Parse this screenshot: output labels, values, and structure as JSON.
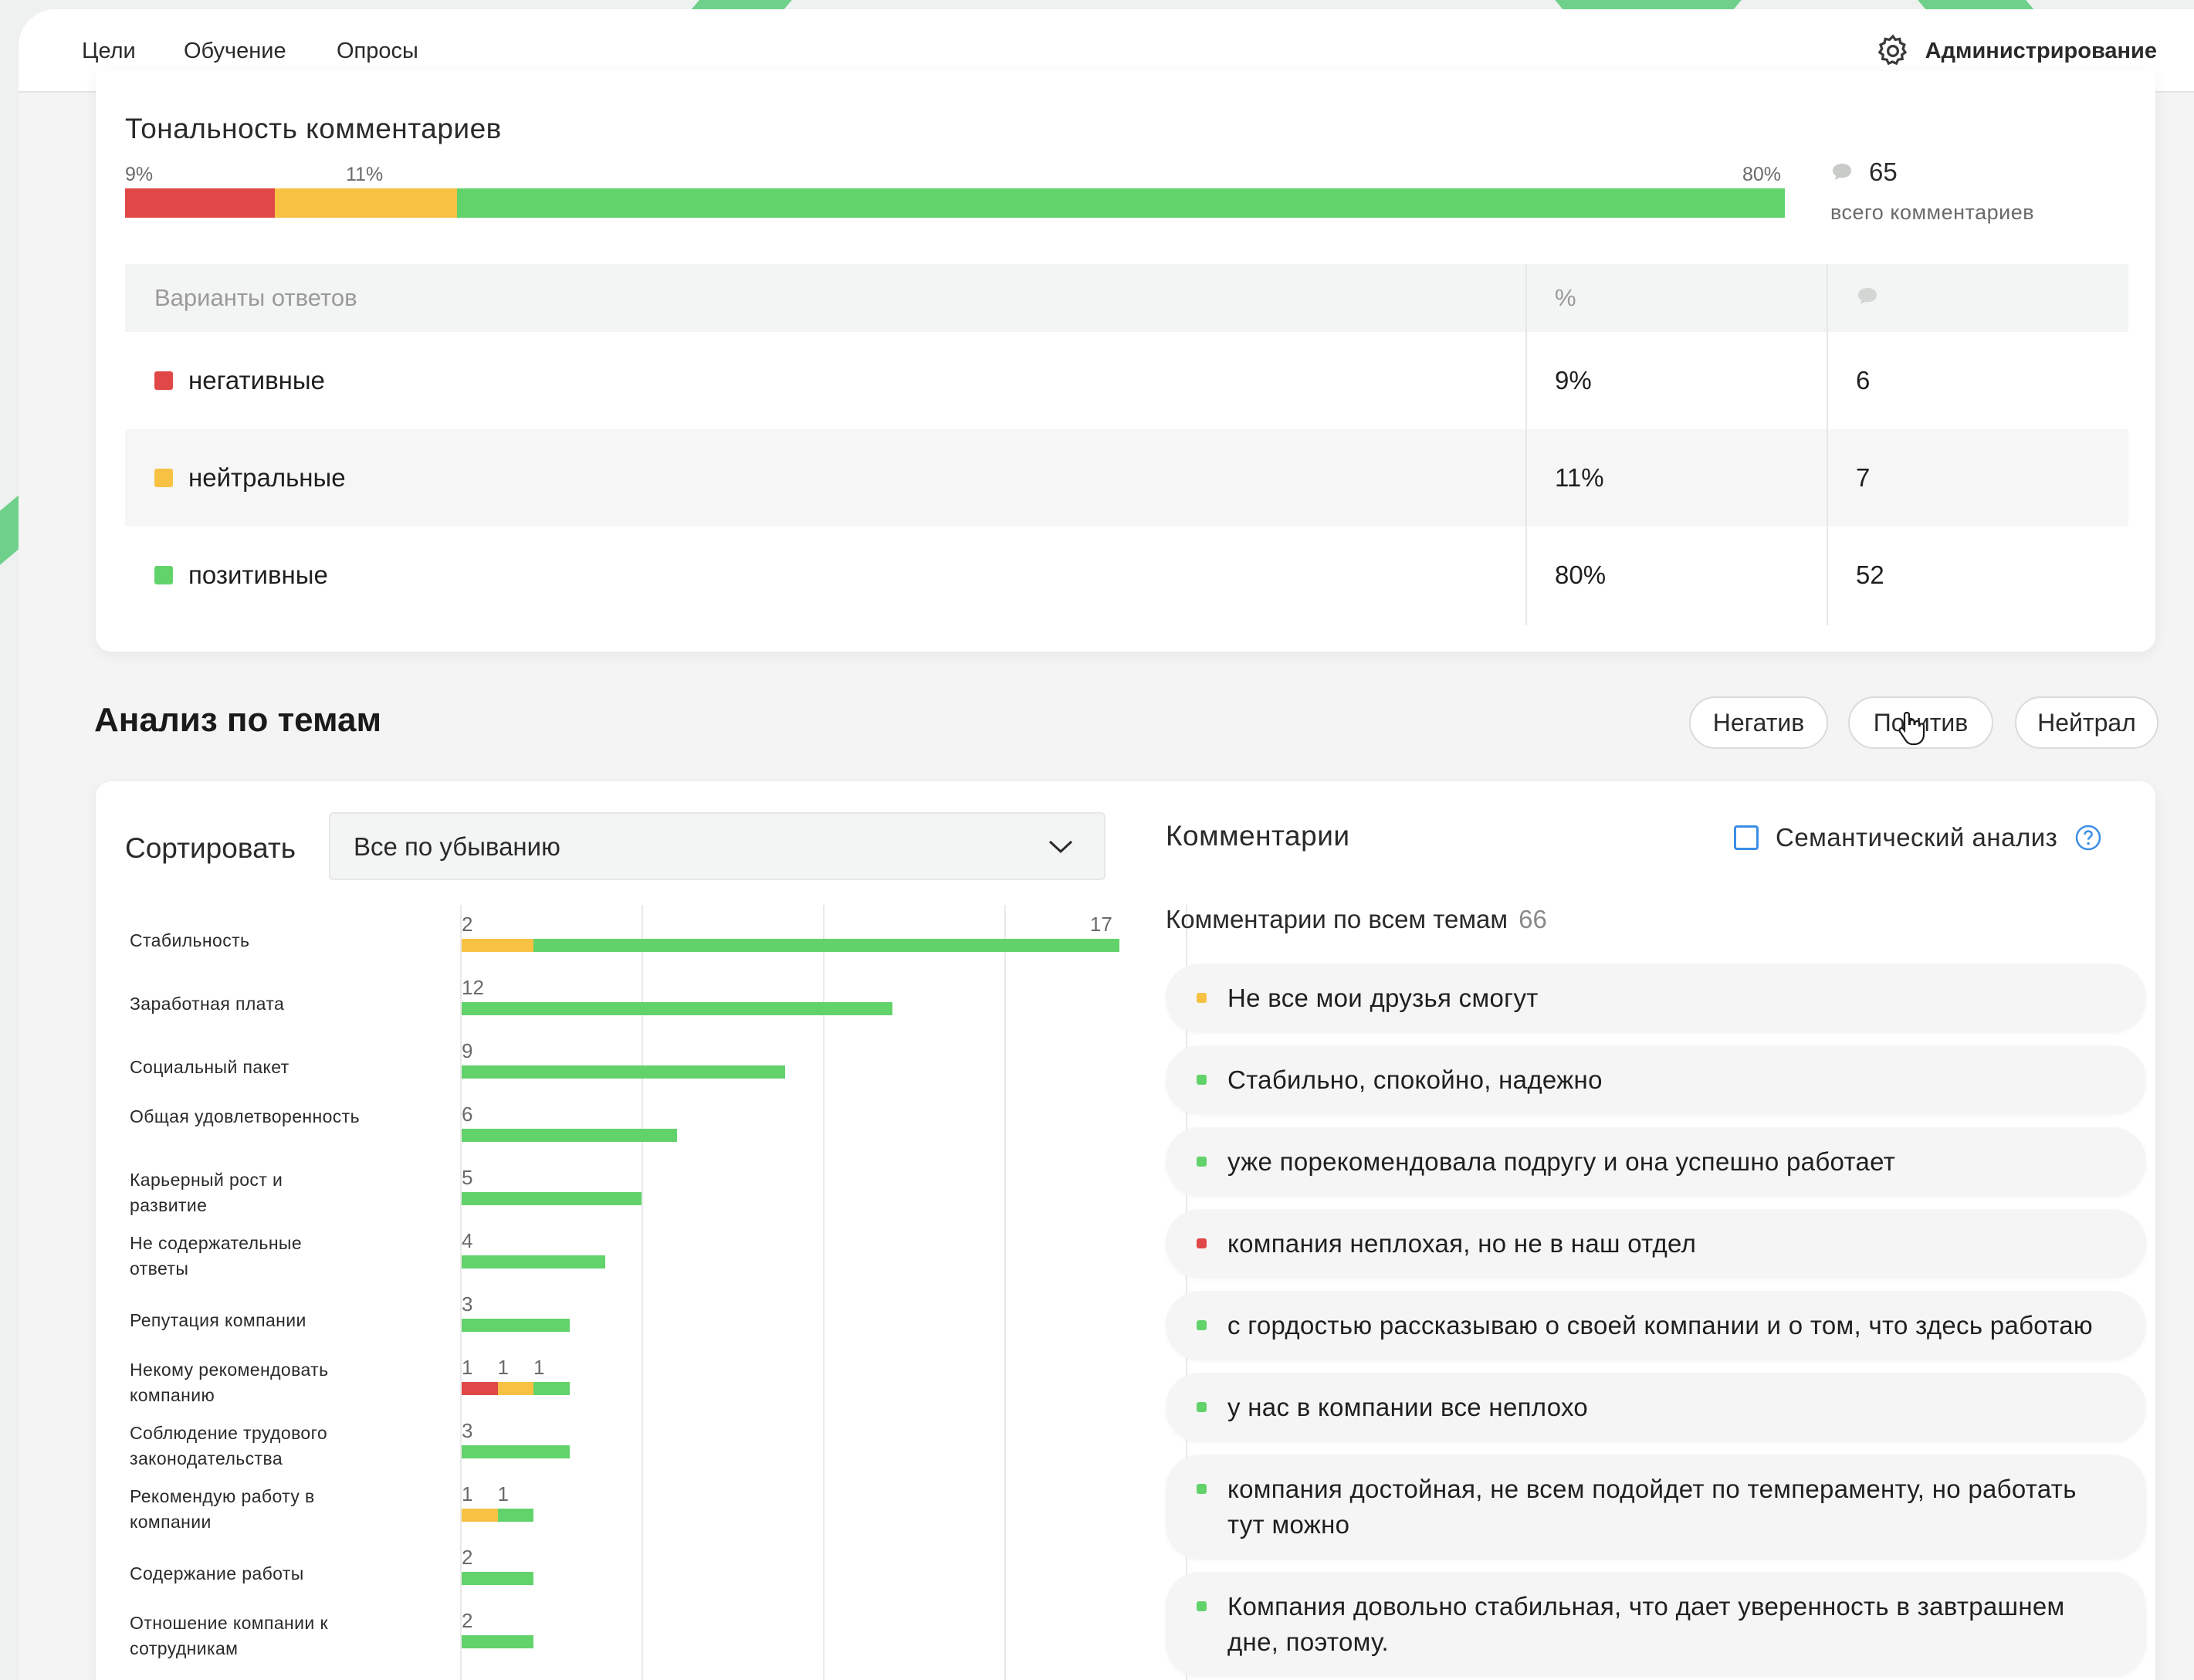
{
  "colors": {
    "negative": "#e04848",
    "neutral": "#f7c244",
    "positive": "#62d26b",
    "accent": "#3a8ee6"
  },
  "nav": {
    "items": [
      {
        "label": "Цели"
      },
      {
        "label": "Обучение"
      },
      {
        "label": "Опросы",
        "active": true
      }
    ],
    "admin_label": "Администрирование",
    "admin_icon": "gear-icon"
  },
  "tonality": {
    "title": "Тональность комментариев",
    "segments": [
      {
        "label": "9%",
        "value": 9,
        "color": "#e04848"
      },
      {
        "label": "11%",
        "value": 11,
        "color": "#f7c244"
      },
      {
        "label": "80%",
        "value": 80,
        "color": "#62d26b"
      }
    ],
    "total": "65",
    "total_label": "всего комментариев",
    "total_icon": "comment-icon"
  },
  "table": {
    "header": {
      "col1": "Варианты ответов",
      "col2": "%",
      "col3_icon": "comment-icon"
    },
    "rows": [
      {
        "label": "негативные",
        "pct": "9%",
        "count": "6",
        "color": "#e04848"
      },
      {
        "label": "нейтральные",
        "pct": "11%",
        "count": "7",
        "color": "#f7c244"
      },
      {
        "label": "позитивные",
        "pct": "80%",
        "count": "52",
        "color": "#62d26b"
      }
    ]
  },
  "themes": {
    "title": "Анализ по темам",
    "filters": [
      "Негатив",
      "Позитив",
      "Нейтрал"
    ]
  },
  "sort": {
    "label": "Сортировать",
    "value": "Все по убыванию"
  },
  "chart_data": {
    "type": "bar",
    "orientation": "horizontal",
    "stacked": true,
    "categories": [
      "Стабильность",
      "Заработная плата",
      "Социальный пакет",
      "Общая удовлетворенность",
      "Карьерный рост и развитие",
      "Не содержательные ответы",
      "Репутация компании",
      "Некому рекомендовать компанию",
      "Соблюдение трудового законодательства",
      "Рекомендую работу в компании",
      "Содержание работы",
      "Отношение компании к сотрудникам"
    ],
    "series": [
      {
        "color": "#e04848",
        "values": [
          0,
          0,
          0,
          0,
          0,
          0,
          0,
          1,
          0,
          0,
          0,
          0
        ]
      },
      {
        "color": "#f7c244",
        "values": [
          2,
          0,
          0,
          0,
          0,
          0,
          0,
          1,
          0,
          1,
          0,
          0
        ]
      },
      {
        "color": "#62d26b",
        "values": [
          17,
          12,
          9,
          6,
          5,
          4,
          3,
          1,
          3,
          1,
          2,
          2
        ]
      }
    ],
    "value_labels": [
      [
        "2",
        "17"
      ],
      [
        "12"
      ],
      [
        "9"
      ],
      [
        "6"
      ],
      [
        "5"
      ],
      [
        "4"
      ],
      [
        "3"
      ],
      [
        "1",
        "1",
        "1"
      ],
      [
        "3"
      ],
      [
        "1",
        "1"
      ],
      [
        "2"
      ],
      [
        "2"
      ]
    ],
    "xlim": [
      0,
      20
    ],
    "grid": true
  },
  "comments": {
    "title": "Комментарии",
    "semantic_label": "Семантический анализ",
    "semantic_checked": false,
    "subtitle": "Комментарии по всем темам",
    "count": "66",
    "items": [
      {
        "text": "Не все мои друзья смогут",
        "color": "#f7c244"
      },
      {
        "text": "Стабильно, спокойно, надежно",
        "color": "#62d26b"
      },
      {
        "text": "уже порекомендовала подругу и она успешно работает",
        "color": "#62d26b"
      },
      {
        "text": "компания неплохая, но не в наш отдел",
        "color": "#e04848"
      },
      {
        "text": "с гордостью рассказываю о своей компании и о том, что здесь работаю",
        "color": "#62d26b"
      },
      {
        "text": "у нас в компании все неплохо",
        "color": "#62d26b"
      },
      {
        "text": "компания достойная, не всем подойдет по темпераменту, но работать тут можно",
        "color": "#62d26b"
      },
      {
        "text": "Компания довольно стабильная, что дает уверенность в завтрашнем дне, поэтому.",
        "color": "#62d26b"
      }
    ]
  }
}
